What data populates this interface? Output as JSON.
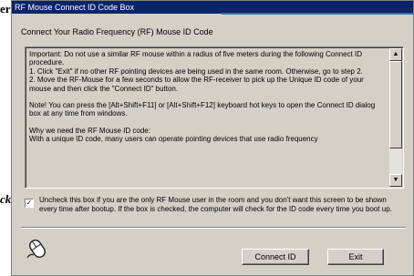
{
  "background": {
    "fragments": [
      "er",
      "ck"
    ]
  },
  "window": {
    "title": "RF Mouse Connect ID Code Box"
  },
  "heading": "Connect Your Radio Frequency (RF) Mouse ID Code",
  "info": {
    "paragraphs": [
      "Important: Do not use a similar RF mouse within a radius of five meters during the following Connect ID procedure.",
      "1. Click \"Exit\" if no other RF pointing devices are being used in the same room. Otherwise, go to step 2.",
      "2. Move the RF-Mouse for a few seconds to allow the RF-receiver to pick up the Unique ID code of your mouse and then click the \"Connect ID\" button.",
      "",
      "Note! You can press the [Alt+Shift+F11] or [Alt+Shift+F12] keyboard hot keys to open the Connect ID dialog box at any time from windows.",
      "",
      "Why we need the RF Mouse ID code:",
      "With a unique ID code, many users can operate pointing devices that use radio frequency"
    ]
  },
  "checkbox": {
    "checked_mark": "✓",
    "label": "Uncheck this box if you are the only RF Mouse user in the room and you don't want this screen to be shown every time after bootup. If the box is checked, the computer will check for the ID code every time you boot up."
  },
  "icons": {
    "scroll_up": "▲",
    "scroll_down": "▼",
    "mouse": "mouse-icon"
  },
  "buttons": {
    "connect": "Connect ID",
    "exit": "Exit"
  }
}
